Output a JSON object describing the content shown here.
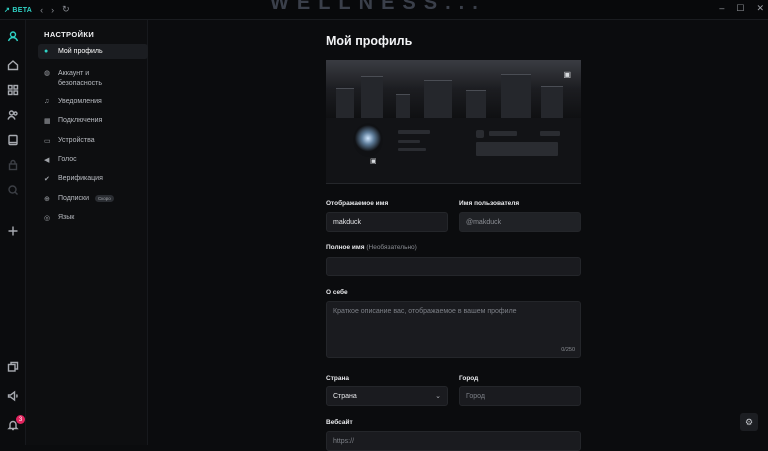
{
  "titlebar": {
    "beta": "BETA",
    "watermark": "WELLNESS..."
  },
  "settings": {
    "heading": "НАСТРОЙКИ",
    "items": [
      {
        "label": "Мой профиль",
        "icon": "user-icon"
      },
      {
        "label": "Аккаунт и безопасность",
        "icon": "shield-icon"
      },
      {
        "label": "Уведомления",
        "icon": "bell-icon"
      },
      {
        "label": "Подключения",
        "icon": "grid-icon"
      },
      {
        "label": "Устройства",
        "icon": "monitor-icon"
      },
      {
        "label": "Голос",
        "icon": "speaker-icon"
      },
      {
        "label": "Верификация",
        "icon": "check-icon"
      },
      {
        "label": "Подписки",
        "icon": "plus-circle-icon",
        "badge": "Скоро"
      },
      {
        "label": "Язык",
        "icon": "globe-icon"
      }
    ]
  },
  "rail": {
    "notification_count": "3"
  },
  "profile": {
    "title": "Мой профиль",
    "display_name_label": "Отображаемое имя",
    "display_name_value": "makduck",
    "username_label": "Имя пользователя",
    "username_value": "@makduck",
    "full_name_label": "Полное имя",
    "full_name_optional": "(Необязательно)",
    "about_label": "О себе",
    "about_placeholder": "Краткое описание вас, отображаемое в вашем профиле",
    "about_counter": "0/250",
    "country_label": "Страна",
    "country_value": "Страна",
    "city_label": "Город",
    "city_value": "Город",
    "website_label": "Вебсайт",
    "website_value": "https://"
  },
  "colors": {
    "accent": "#2fd3c6",
    "badge": "#e0245e"
  }
}
